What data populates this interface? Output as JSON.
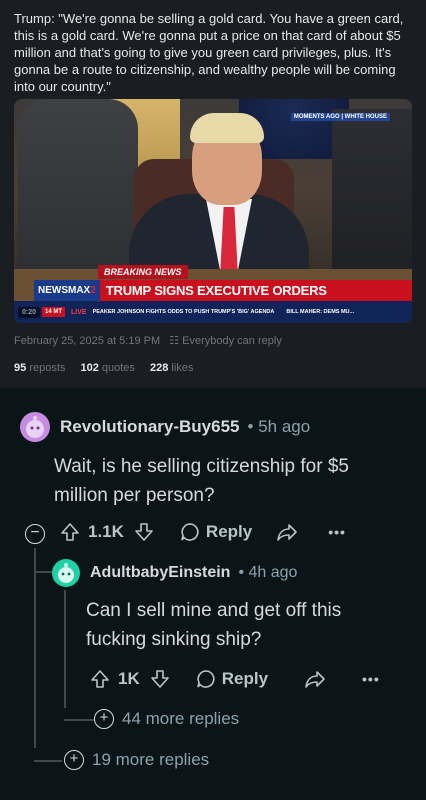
{
  "tweet": {
    "text": "Trump: \"We're gonna be selling a gold card. You have a green card, this is a gold card. We're gonna put a price on that card of about $5 million and that's going to give you green card privileges, plus. It's gonna be a route to citizenship, and wealthy people will be coming into our country.\"",
    "video": {
      "top_badge": "MOMENTS AGO | WHITE HOUSE",
      "breaking": "BREAKING NEWS",
      "network": "NEWSMAX",
      "network_num": "2",
      "headline": "TRUMP SIGNS EXECUTIVE ORDERS",
      "timestamp": "0:20",
      "mt": "14 MT",
      "live": "LIVE",
      "crawl_1": "PEAKER JOHNSON FIGHTS ODDS TO PUSH TRUMP'S 'BIG' AGENDA",
      "crawl_2": "BILL MAHER: DEMS MU..."
    },
    "meta": "February 25, 2025 at 5:19 PM",
    "reply_setting": "Everybody can reply",
    "reposts_count": "95",
    "reposts_label": "reposts",
    "quotes_count": "102",
    "quotes_label": "quotes",
    "likes_count": "228",
    "likes_label": "likes"
  },
  "comments": [
    {
      "username": "Revolutionary-Buy655",
      "time": "5h ago",
      "body": "Wait, is he selling citizenship for $5 million per person?",
      "votes": "1.1K",
      "reply_label": "Reply",
      "avatar_color": "#c58ce0"
    },
    {
      "username": "AdultbabyEinstein",
      "time": "4h ago",
      "body": "Can I sell mine and get off this fucking sinking ship?",
      "votes": "1K",
      "reply_label": "Reply",
      "avatar_color": "#1fd1a5"
    }
  ],
  "more_replies_nested": "44 more replies",
  "more_replies_top": "19 more replies",
  "colors": {
    "background": "#0b1416",
    "text": "#d7dadc",
    "muted": "#8ba2ad"
  }
}
